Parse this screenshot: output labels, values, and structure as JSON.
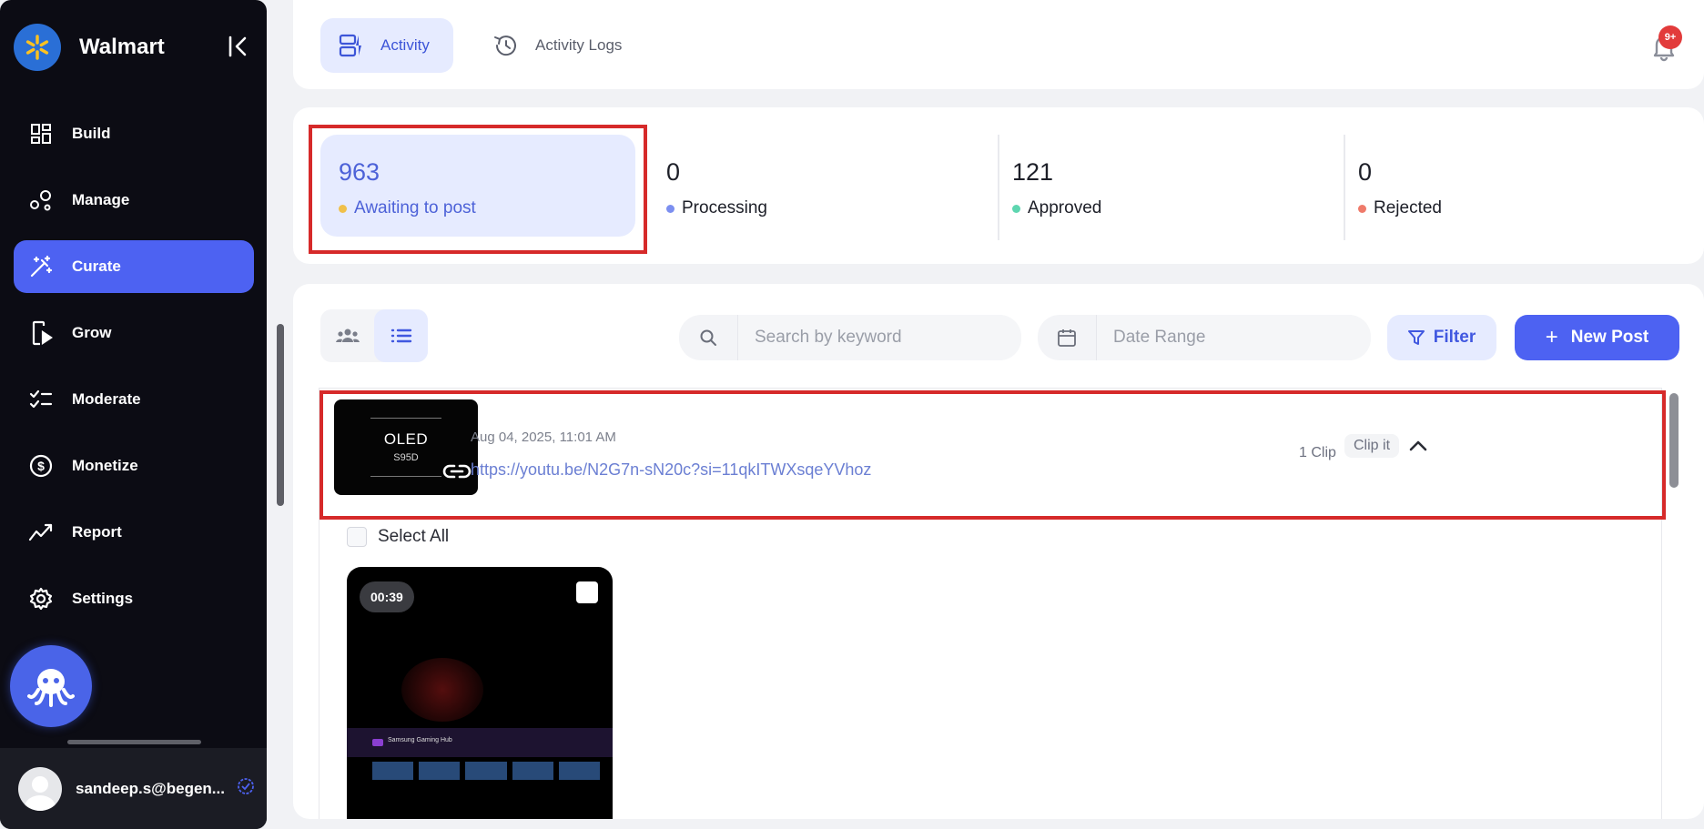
{
  "sidebar": {
    "brand": "Walmart",
    "nav": [
      {
        "label": "Build",
        "icon": "grid-icon"
      },
      {
        "label": "Manage",
        "icon": "nodes-icon"
      },
      {
        "label": "Curate",
        "icon": "magic-wand-icon",
        "active": true
      },
      {
        "label": "Grow",
        "icon": "phone-play-icon"
      },
      {
        "label": "Moderate",
        "icon": "checklist-icon"
      },
      {
        "label": "Monetize",
        "icon": "dollar-circle-icon"
      },
      {
        "label": "Report",
        "icon": "trend-icon"
      },
      {
        "label": "Settings",
        "icon": "gear-icon"
      }
    ],
    "user_email": "sandeep.s@begen..."
  },
  "header": {
    "tabs": [
      {
        "label": "Activity",
        "icon": "activity-icon",
        "active": true
      },
      {
        "label": "Activity Logs",
        "icon": "history-icon",
        "active": false
      }
    ],
    "notification_badge": "9+"
  },
  "stats": [
    {
      "value": "963",
      "label": "Awaiting to post",
      "dot_color": "#f0c04a"
    },
    {
      "value": "0",
      "label": "Processing",
      "dot_color": "#7c8ff0"
    },
    {
      "value": "121",
      "label": "Approved",
      "dot_color": "#5ed6b0"
    },
    {
      "value": "0",
      "label": "Rejected",
      "dot_color": "#ef7a6a"
    }
  ],
  "toolbar": {
    "search_placeholder": "Search by keyword",
    "date_placeholder": "Date Range",
    "filter_label": "Filter",
    "new_post_label": "New Post"
  },
  "post": {
    "thumb_title": "OLED",
    "thumb_subtitle": "S95D",
    "date": "Aug 04, 2025, 11:01 AM",
    "url": "https://youtu.be/N2G7n-sN20c?si=11qkITWXsqeYVhoz",
    "clip_count": "1 Clip",
    "clip_it_label": "Clip it"
  },
  "clips": {
    "select_all_label": "Select All",
    "items": [
      {
        "duration": "00:39",
        "caption": "Samsung Gaming Hub"
      }
    ]
  },
  "colors": {
    "accent": "#4d62f2",
    "sidebar_bg": "#0c0c14",
    "highlight": "#d62a2a"
  }
}
